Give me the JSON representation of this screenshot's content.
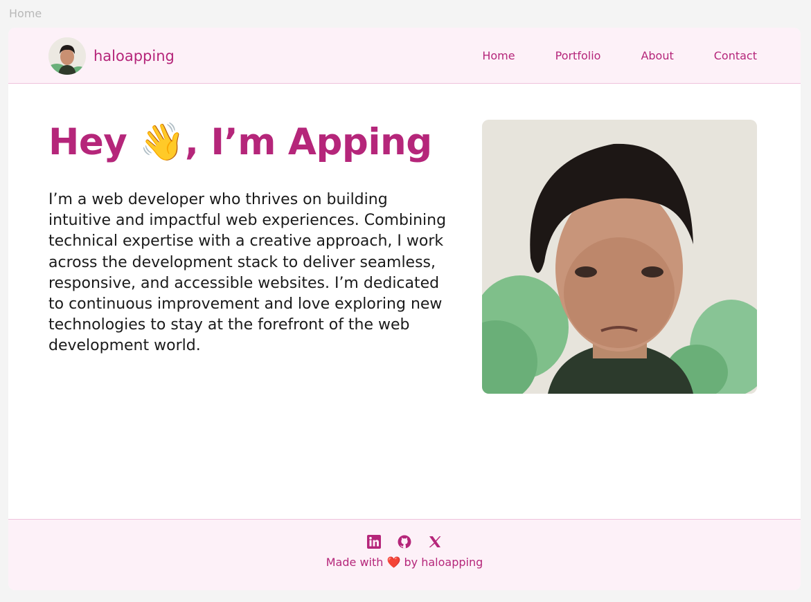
{
  "browser": {
    "tab_label": "Home"
  },
  "header": {
    "brand": "haloapping",
    "nav": [
      {
        "label": "Home"
      },
      {
        "label": "Portfolio"
      },
      {
        "label": "About"
      },
      {
        "label": "Contact"
      }
    ]
  },
  "hero": {
    "title_prefix": "Hey ",
    "wave_icon": "👋",
    "title_suffix": ", I’m Apping",
    "description": "I’m a web developer who thrives on building intuitive and impactful web experiences. Combining technical expertise with a creative approach, I work across the development stack to deliver seamless, responsive, and accessible websites. I’m dedicated to continuous improvement and love exploring new technologies to stay at the forefront of the web development world."
  },
  "footer": {
    "socials": [
      "linkedin-icon",
      "github-icon",
      "x-icon"
    ],
    "made_prefix": "Made with ",
    "heart": "❤️",
    "made_suffix": " by haloapping"
  },
  "colors": {
    "accent": "#b5267a",
    "header_bg": "#fdf1f8",
    "border": "#efc2dc",
    "text": "#1a1a1a"
  }
}
